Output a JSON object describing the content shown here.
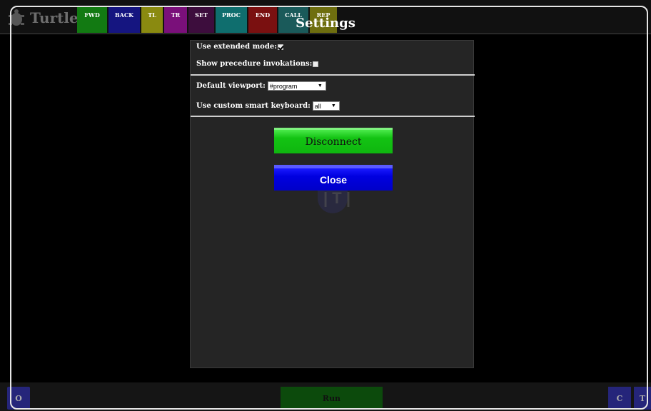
{
  "app": {
    "brand": "Turtle"
  },
  "toolbar": {
    "tabs": [
      {
        "label": "FWD",
        "color": "#127a12"
      },
      {
        "label": "BACK",
        "color": "#151580"
      },
      {
        "label": "TL",
        "color": "#8a8a10"
      },
      {
        "label": "TR",
        "color": "#7a107a"
      },
      {
        "label": "SET",
        "color": "#3d0d3d"
      },
      {
        "label": "PROC",
        "color": "#0f6e6e"
      },
      {
        "label": "END",
        "color": "#7a1010"
      },
      {
        "label": "CALL",
        "color": "#1a5a5a"
      },
      {
        "label": "REP",
        "color": "#6e6e0f"
      }
    ]
  },
  "settings": {
    "title": "Settings",
    "extended_mode_label": "Use extended mode:",
    "extended_mode_checked": true,
    "show_invocations_label": "Show precedure invokations:",
    "show_invocations_checked": false,
    "viewport_label": "Default viewport:",
    "viewport_value": "#program",
    "keyboard_label": "Use custom smart keyboard:",
    "keyboard_value": "all",
    "disconnect_label": "Disconnect",
    "close_label": "Close"
  },
  "bottom": {
    "o_label": "O",
    "run_label": "Run",
    "c_label": "C",
    "t_label": "T"
  }
}
